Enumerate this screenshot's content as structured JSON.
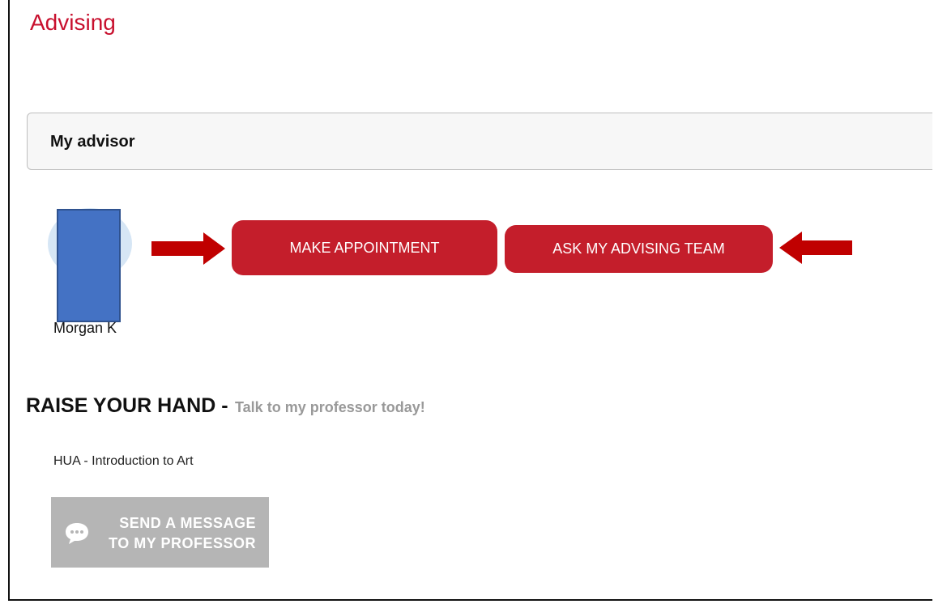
{
  "page": {
    "title": "Advising"
  },
  "advisor_panel": {
    "title": "My advisor",
    "advisor_name": "Morgan K"
  },
  "actions": {
    "make_appointment_label": "MAKE APPOINTMENT",
    "ask_team_label": "ASK MY ADVISING TEAM"
  },
  "raise_hand": {
    "title": "RAISE YOUR HAND -",
    "subtitle": "Talk to my professor today!",
    "course": "HUA - Introduction to Art",
    "message_button_line1": "SEND A MESSAGE",
    "message_button_line2": "TO MY PROFESSOR"
  },
  "colors": {
    "brand_red": "#c41e2b",
    "title_red": "#c8102e",
    "annotation_arrow": "#c00000",
    "redaction_blue": "#4472c4",
    "disabled_gray": "#b5b5b5"
  },
  "icons": {
    "arrow_right": "arrow-right-icon",
    "arrow_left": "arrow-left-icon",
    "chat": "chat-bubble-icon"
  }
}
